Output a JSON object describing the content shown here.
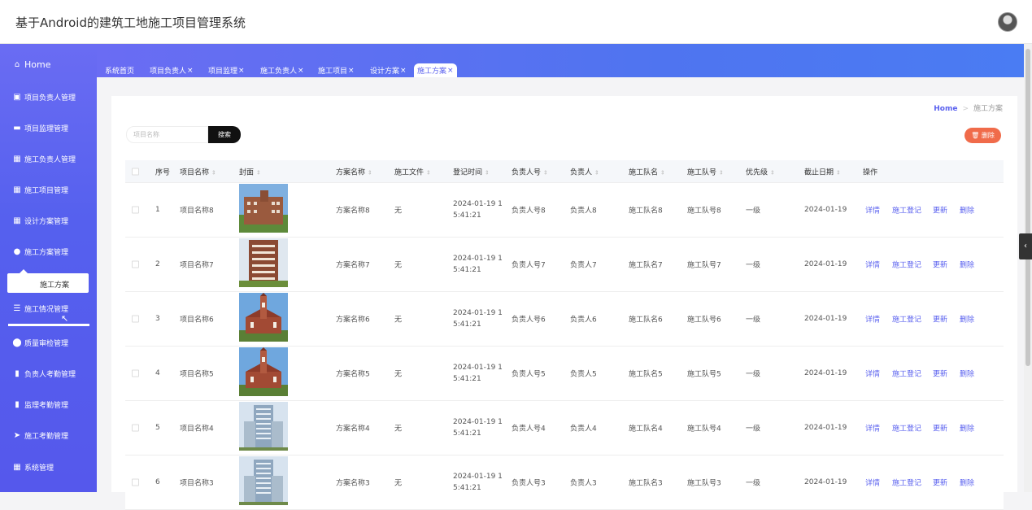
{
  "app": {
    "title": "基于Android的建筑工地施工项目管理系统"
  },
  "sidebar": {
    "items": [
      {
        "label": "Home",
        "icon": "home-icon"
      },
      {
        "label": "项目负责人管理",
        "icon": "clipboard-icon"
      },
      {
        "label": "项目监理管理",
        "icon": "briefcase-icon"
      },
      {
        "label": "施工负责人管理",
        "icon": "grid-icon"
      },
      {
        "label": "施工项目管理",
        "icon": "grid-icon"
      },
      {
        "label": "设计方案管理",
        "icon": "grid-icon"
      },
      {
        "label": "施工方案管理",
        "icon": "user-icon"
      },
      {
        "label": "施工情况管理",
        "icon": "list-icon"
      },
      {
        "label": "质量审检管理",
        "icon": "pin-icon"
      },
      {
        "label": "负责人考勤管理",
        "icon": "book-icon"
      },
      {
        "label": "监理考勤管理",
        "icon": "bar-chart-icon"
      },
      {
        "label": "施工考勤管理",
        "icon": "send-icon"
      },
      {
        "label": "系统管理",
        "icon": "grid-icon"
      }
    ],
    "submenu_label": "施工方案"
  },
  "tabs": [
    {
      "label": "系统首页",
      "closable": false
    },
    {
      "label": "项目负责人",
      "closable": true
    },
    {
      "label": "项目监理",
      "closable": true
    },
    {
      "label": "施工负责人",
      "closable": true
    },
    {
      "label": "施工项目",
      "closable": true
    },
    {
      "label": "设计方案",
      "closable": true
    },
    {
      "label": "施工方案",
      "closable": true,
      "active": true
    }
  ],
  "tab_close": "×",
  "breadcrumb": {
    "home": "Home",
    "current": "施工方案"
  },
  "search": {
    "placeholder": "项目名称",
    "button": "搜索"
  },
  "delete_button": "删除",
  "table": {
    "headers": [
      "序号",
      "项目名称",
      "封面",
      "方案名称",
      "施工文件",
      "登记时间",
      "负责人号",
      "负责人",
      "施工队名",
      "施工队号",
      "优先级",
      "截止日期",
      "操作"
    ],
    "actions": [
      "详情",
      "施工登记",
      "更新",
      "删除"
    ],
    "rows": [
      {
        "no": "1",
        "project": "项目名称8",
        "plan": "方案名称8",
        "file": "无",
        "time1": "2024-01-19 1",
        "time2": "5:41:21",
        "lead_no": "负责人号8",
        "lead": "负责人8",
        "team": "施工队名8",
        "team_no": "施工队号8",
        "priority": "一级",
        "deadline": "2024-01-19",
        "cover": "brick"
      },
      {
        "no": "2",
        "project": "项目名称7",
        "plan": "方案名称7",
        "file": "无",
        "time1": "2024-01-19 1",
        "time2": "5:41:21",
        "lead_no": "负责人号7",
        "lead": "负责人7",
        "team": "施工队名7",
        "team_no": "施工队号7",
        "priority": "一级",
        "deadline": "2024-01-19",
        "cover": "tower"
      },
      {
        "no": "3",
        "project": "项目名称6",
        "plan": "方案名称6",
        "file": "无",
        "time1": "2024-01-19 1",
        "time2": "5:41:21",
        "lead_no": "负责人号6",
        "lead": "负责人6",
        "team": "施工队名6",
        "team_no": "施工队号6",
        "priority": "一级",
        "deadline": "2024-01-19",
        "cover": "church"
      },
      {
        "no": "4",
        "project": "项目名称5",
        "plan": "方案名称5",
        "file": "无",
        "time1": "2024-01-19 1",
        "time2": "5:41:21",
        "lead_no": "负责人号5",
        "lead": "负责人5",
        "team": "施工队名5",
        "team_no": "施工队号5",
        "priority": "一级",
        "deadline": "2024-01-19",
        "cover": "church"
      },
      {
        "no": "5",
        "project": "项目名称4",
        "plan": "方案名称4",
        "file": "无",
        "time1": "2024-01-19 1",
        "time2": "5:41:21",
        "lead_no": "负责人号4",
        "lead": "负责人4",
        "team": "施工队名4",
        "team_no": "施工队号4",
        "priority": "一级",
        "deadline": "2024-01-19",
        "cover": "glass"
      },
      {
        "no": "6",
        "project": "项目名称3",
        "plan": "方案名称3",
        "file": "无",
        "time1": "2024-01-19 1",
        "time2": "5:41:21",
        "lead_no": "负责人号3",
        "lead": "负责人3",
        "team": "施工队名3",
        "team_no": "施工队号3",
        "priority": "一级",
        "deadline": "2024-01-19",
        "cover": "glass"
      }
    ]
  },
  "colors": {
    "accent": "#5b62ef",
    "sidebar": "#5558ec",
    "danger": "#f06b4a"
  }
}
